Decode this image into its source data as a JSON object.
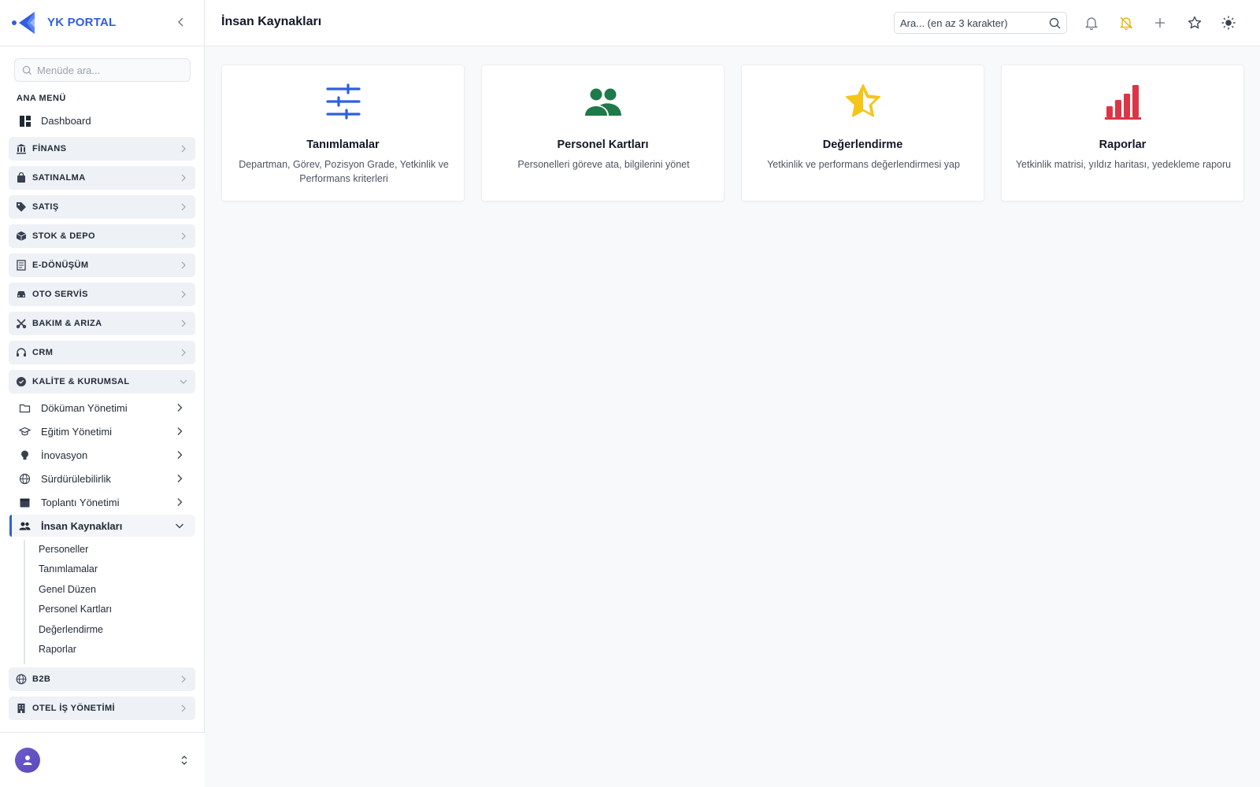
{
  "brand": {
    "name": "YK PORTAL"
  },
  "sidebar": {
    "search_placeholder": "Menüde ara...",
    "section_label": "ANA MENÜ",
    "dashboard": "Dashboard",
    "groups": [
      {
        "label": "FİNANS",
        "icon": "bank-icon"
      },
      {
        "label": "SATINALMA",
        "icon": "shopping-bag-icon"
      },
      {
        "label": "SATIŞ",
        "icon": "tag-icon"
      },
      {
        "label": "STOK & DEPO",
        "icon": "box-icon"
      },
      {
        "label": "E-DÖNÜŞÜM",
        "icon": "document-icon"
      },
      {
        "label": "OTO SERVİS",
        "icon": "car-icon"
      },
      {
        "label": "BAKIM & ARIZA",
        "icon": "tools-icon"
      },
      {
        "label": "CRM",
        "icon": "headset-icon"
      },
      {
        "label": "KALİTE & KURUMSAL",
        "icon": "badge-check-icon",
        "expanded": true
      }
    ],
    "kalite_items": [
      {
        "label": "Döküman Yönetimi",
        "icon": "folder-icon"
      },
      {
        "label": "Eğitim Yönetimi",
        "icon": "graduation-cap-icon"
      },
      {
        "label": "İnovasyon",
        "icon": "lightbulb-icon"
      },
      {
        "label": "Sürdürülebilirlik",
        "icon": "globe-icon"
      },
      {
        "label": "Toplantı Yönetimi",
        "icon": "calendar-icon"
      },
      {
        "label": "İnsan Kaynakları",
        "icon": "users-icon",
        "active": true
      }
    ],
    "hr_links": [
      "Personeller",
      "Tanımlamalar",
      "Genel Düzen",
      "Personel Kartları",
      "Değerlendirme",
      "Raporlar"
    ],
    "bottom_groups": [
      {
        "label": "B2B",
        "icon": "globe-icon"
      },
      {
        "label": "OTEL İŞ YÖNETİMİ",
        "icon": "building-icon"
      }
    ]
  },
  "header": {
    "title": "İnsan Kaynakları",
    "search_placeholder": "Ara... (en az 3 karakter)",
    "icons": [
      "bell-icon",
      "bell-off-icon",
      "plus-icon",
      "star-icon",
      "sun-icon"
    ]
  },
  "cards": [
    {
      "title": "Tanımlamalar",
      "desc": "Departman, Görev, Pozisyon Grade, Yetkinlik ve Performans kriterleri",
      "icon": "sliders-icon",
      "color": "#2f5fe0"
    },
    {
      "title": "Personel Kartları",
      "desc": "Personelleri göreve ata, bilgilerini yönet",
      "icon": "users-icon",
      "color": "#1e7a48"
    },
    {
      "title": "Değerlendirme",
      "desc": "Yetkinlik ve performans değerlendirmesi yap",
      "icon": "star-half-icon",
      "color": "#f5c518"
    },
    {
      "title": "Raporlar",
      "desc": "Yetkinlik matrisi, yıldız haritası, yedekleme raporu",
      "icon": "bar-chart-icon",
      "color": "#dc3545"
    }
  ],
  "colors": {
    "accent": "#2f5fe0",
    "sidebar_group_bg": "#eef1f6",
    "page_bg": "#f8f9fb"
  }
}
